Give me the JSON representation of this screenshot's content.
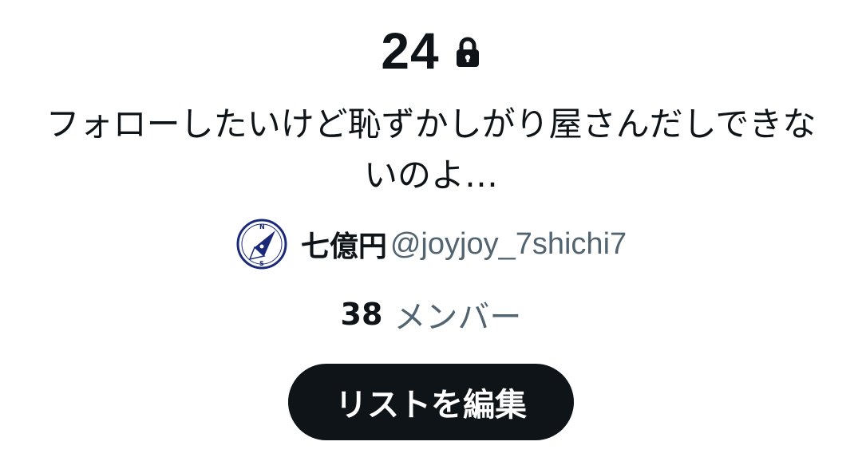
{
  "list": {
    "title": "24",
    "lock_icon": "lock-icon",
    "description": "フォローしたいけど恥ずかしがり屋さんだしできないのよ…"
  },
  "owner": {
    "name": "七億円",
    "handle": "@joyjoy_7shichi7",
    "avatar_icon": "compass-avatar"
  },
  "members": {
    "count": "38",
    "label": "メンバー"
  },
  "actions": {
    "edit_label": "リストを編集"
  },
  "colors": {
    "text_primary": "#0f1419",
    "text_secondary": "#536471",
    "button_bg": "#0f1419",
    "button_text": "#ffffff",
    "avatar_navy": "#1b2a78"
  }
}
